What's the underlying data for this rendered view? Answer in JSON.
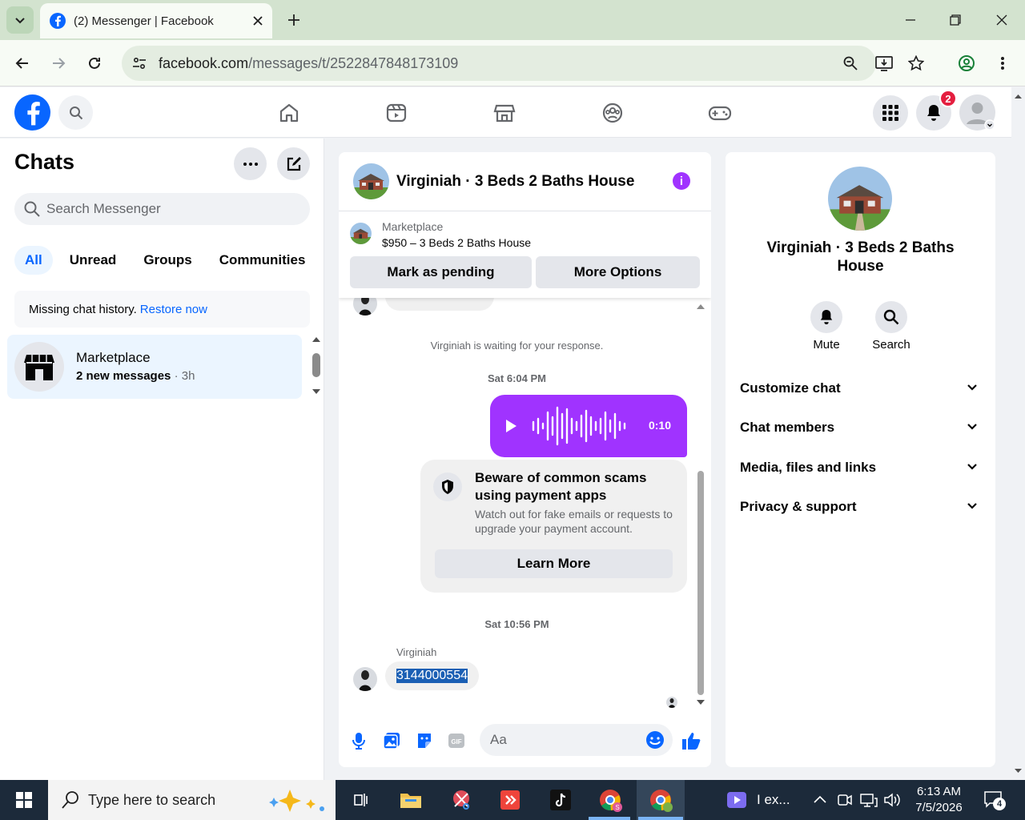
{
  "browser": {
    "tab_title": "(2) Messenger | Facebook",
    "url_host": "facebook.com",
    "url_path": "/messages/t/2522847848173109"
  },
  "header": {
    "notifications_count": "2"
  },
  "sidebar": {
    "title": "Chats",
    "search_placeholder": "Search Messenger",
    "filters": [
      {
        "label": "All"
      },
      {
        "label": "Unread"
      },
      {
        "label": "Groups"
      },
      {
        "label": "Communities"
      }
    ],
    "notice_text": "Missing chat history.",
    "notice_link": "Restore now",
    "chats": [
      {
        "name": "Marketplace",
        "preview": "2 new messages",
        "time": " · 3h"
      }
    ]
  },
  "conversation": {
    "title": "Virginiah · 3 Beds 2 Baths House",
    "marketplace_label": "Marketplace",
    "listing": "$950 – 3 Beds 2 Baths House",
    "mark_pending": "Mark as pending",
    "more_options": "More Options",
    "waiting_note": "Virginiah is waiting for your response.",
    "time1": "Sat 6:04 PM",
    "audio_duration": "0:10",
    "warning_title": "Beware of common scams using payment apps",
    "warning_desc": "Watch out for fake emails or requests to upgrade your payment account.",
    "learn_more": "Learn More",
    "time2": "Sat 10:56 PM",
    "sender": "Virginiah",
    "phone_message": "3144000554",
    "composer_placeholder": "Aa"
  },
  "info_panel": {
    "name": "Virginiah · 3 Beds 2 Baths House",
    "mute": "Mute",
    "search": "Search",
    "sections": [
      {
        "label": "Customize chat"
      },
      {
        "label": "Chat members"
      },
      {
        "label": "Media, files and links"
      },
      {
        "label": "Privacy & support"
      }
    ]
  },
  "taskbar": {
    "search_placeholder": "Type here to search",
    "running_app_label": "I ex...",
    "time": "6:13 AM",
    "date": "7/5/2026",
    "notifications": "4"
  },
  "colors": {
    "facebook_blue": "#0866ff",
    "messenger_purple": "#a033ff",
    "chrome_green": "#d3e3cf"
  }
}
